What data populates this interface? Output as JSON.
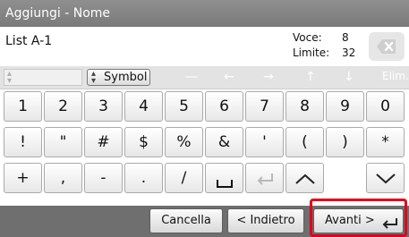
{
  "title": "Aggiungi - Nome",
  "entry": {
    "text": "List A-1"
  },
  "counter": {
    "voce_label": "Voce:",
    "voce_value": "8",
    "limite_label": "Limite:",
    "limite_value": "32"
  },
  "modebar": {
    "symbol_label": "Symbol",
    "nav_icons": [
      "minus-icon",
      "arrow-left-icon",
      "arrow-right-icon",
      "arrow-up-icon",
      "arrow-down-icon"
    ],
    "elim_label": "Elim."
  },
  "keys": {
    "row1": [
      "1",
      "2",
      "3",
      "4",
      "5",
      "6",
      "7",
      "8",
      "9",
      "0"
    ],
    "row2": [
      "!",
      "\"",
      "#",
      "$",
      "%",
      "&",
      "'",
      "(",
      ")",
      "*"
    ],
    "row3": [
      "+",
      ",",
      "-",
      ".",
      "/"
    ]
  },
  "footer": {
    "cancel_label": "Cancella",
    "back_label": "< Indietro",
    "next_label": "Avanti >"
  },
  "colors": {
    "title_bg": "#8a8a8a",
    "footer_bg": "#6f6f6f",
    "highlight": "#e0001b"
  }
}
